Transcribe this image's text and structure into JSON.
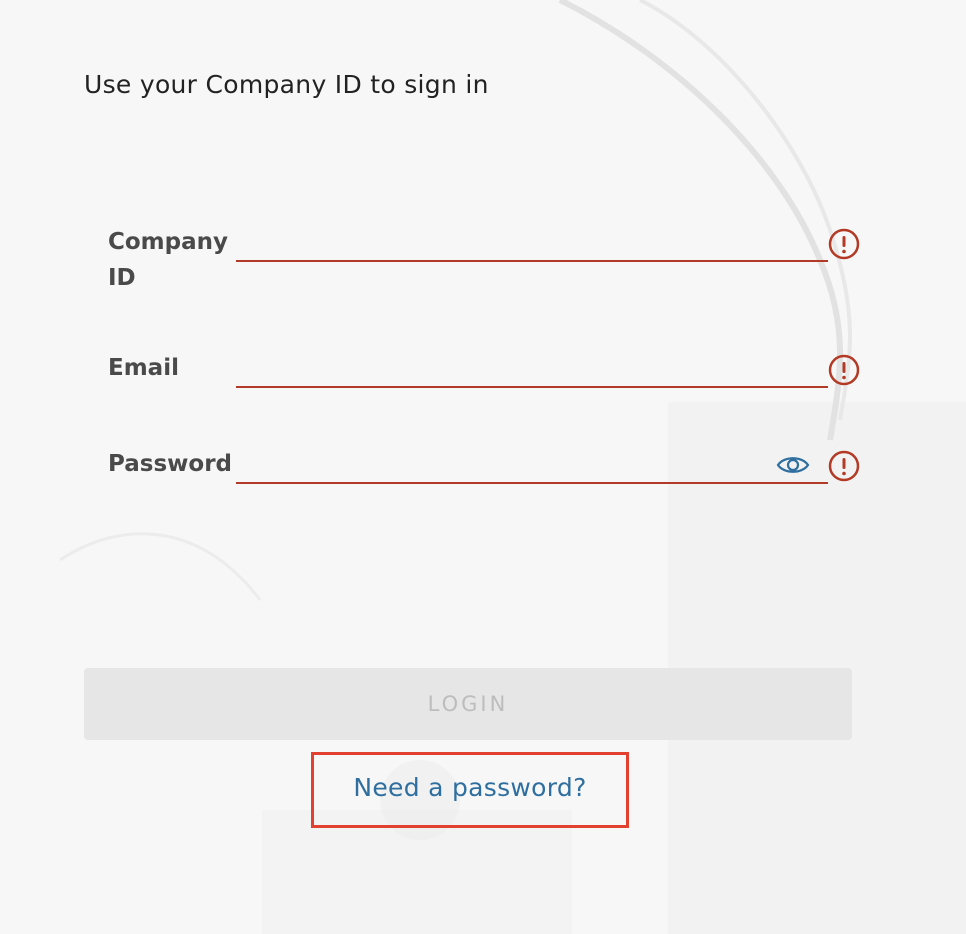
{
  "form": {
    "heading": "Use your Company ID to sign in",
    "fields": [
      {
        "label": "Company ID",
        "value": "",
        "placeholder": ""
      },
      {
        "label": "Email",
        "value": "",
        "placeholder": ""
      },
      {
        "label": "Password",
        "value": "",
        "placeholder": ""
      }
    ],
    "login_label": "LOGIN",
    "need_password_label": "Need a password?"
  },
  "icons": {
    "error": "error-exclamation-icon",
    "show_password": "eye-icon"
  },
  "colors": {
    "error": "#b33a25",
    "link": "#2f6fa0",
    "highlight_box": "#e3412f",
    "button_disabled_bg": "#e6e6e6",
    "button_disabled_text": "#bdbdbd"
  }
}
